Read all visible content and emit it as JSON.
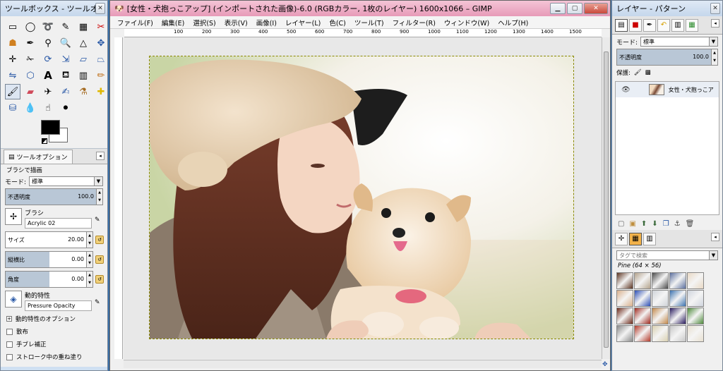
{
  "toolbox": {
    "title": "ツールボックス - ツールオプ...",
    "tools": [
      "rect-select",
      "ellipse-select",
      "lasso",
      "fuzzy-select",
      "color-select",
      "scissors",
      "foreground-select",
      "paths",
      "color-picker",
      "zoom",
      "measure",
      "move",
      "align",
      "crop",
      "rotate",
      "scale",
      "shear",
      "perspective",
      "flip",
      "cage",
      "text",
      "bucket-fill",
      "blend",
      "pencil",
      "paintbrush",
      "eraser",
      "airbrush",
      "ink",
      "clone",
      "heal",
      "perspective-clone",
      "blur",
      "smudge",
      "dodge-burn"
    ],
    "colors": {
      "fg": "#000000",
      "bg": "#ffffff"
    },
    "options_tab_label": "ツールオプション",
    "options_title": "ブラシで描画",
    "mode_label": "モード:",
    "mode_value": "標準",
    "opacity_label": "不透明度",
    "opacity_value": "100.0",
    "brush_label": "ブラシ",
    "brush_value": "Acrylic 02",
    "size_label": "サイズ",
    "size_value": "20.00",
    "aspect_label": "縦横比",
    "aspect_value": "0.00",
    "angle_label": "角度",
    "angle_value": "0.00",
    "dynamics_label": "動的特性",
    "dynamics_value": "Pressure Opacity",
    "dynamics_options_label": "動的特性のオプション",
    "scatter_label": "散布",
    "jitter_label": "手ブレ補正",
    "incremental_label": "ストローク中の重ね塗り"
  },
  "image_window": {
    "title": "[女性・犬抱っこアップ] (インポートされた画像)-6.0 (RGBカラー, 1枚のレイヤー) 1600x1066 – GIMP",
    "menu": [
      "ファイル(F)",
      "編集(E)",
      "選択(S)",
      "表示(V)",
      "画像(I)",
      "レイヤー(L)",
      "色(C)",
      "ツール(T)",
      "フィルター(R)",
      "ウィンドウ(W)",
      "ヘルプ(H)"
    ],
    "ruler_labels": [
      "100",
      "200",
      "300",
      "400",
      "500",
      "600",
      "700",
      "800",
      "900",
      "1000",
      "1100",
      "1200",
      "1300",
      "1400",
      "1500"
    ]
  },
  "layers_panel": {
    "title": "レイヤー - パターン",
    "mode_label": "モード:",
    "mode_value": "標準",
    "opacity_label": "不透明度",
    "opacity_value": "100.0",
    "lock_label": "保護:",
    "layer_name": "女性・犬抱っこア",
    "tag_placeholder": "タグで検索",
    "pattern_name": "Pine (64 × 56)",
    "patterns": [
      "#5b3320",
      "#b4a38c",
      "#4a4a4a",
      "#5b6f9e",
      "#e9d9c5",
      "#d9b08c",
      "#2d4fb5",
      "#cfd3d8",
      "#3c73b0",
      "#d0d5de",
      "#6e2a1a",
      "#a02a1f",
      "#c2884a",
      "#2b1d60",
      "#4e8a3b",
      "#8a8a8a",
      "#b33a2a",
      "#d9d0b0",
      "#c7c7c7",
      "#e8e0d0"
    ]
  }
}
